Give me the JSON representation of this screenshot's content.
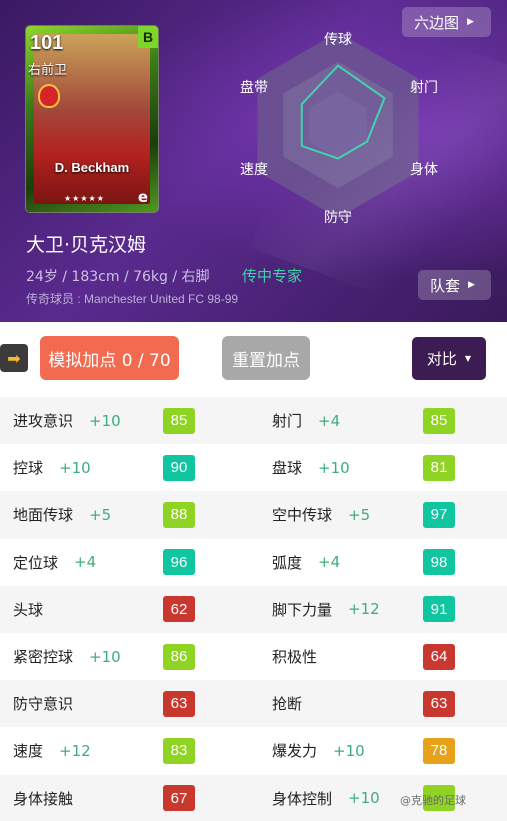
{
  "card": {
    "rating": "101",
    "grade": "B",
    "position": "右前卫",
    "name": "D. Beckham",
    "stars": "★★★★★",
    "e_mark": "e"
  },
  "radar": {
    "labels": [
      "传球",
      "射门",
      "身体",
      "防守",
      "速度",
      "盘带"
    ],
    "values": [
      0.85,
      0.77,
      0.48,
      0.48,
      0.6,
      0.6
    ],
    "fill_color": "#6f5a9a",
    "stroke_color": "#3fd3b0"
  },
  "buttons": {
    "hexagon": "六边图",
    "kit": "队套",
    "simulate": "模拟加点 0 / 70",
    "reset": "重置加点",
    "compare": "对比"
  },
  "player": {
    "name": "大卫·贝克汉姆",
    "info": "24岁 / 183cm / 76kg / 右脚",
    "trait": "传中专家",
    "club": "传奇球员 : Manchester United FC 98-99"
  },
  "colors": {
    "green": "#8fd323",
    "teal": "#10c6a0",
    "red": "#c8382e",
    "orange": "#e8a21a"
  },
  "stats": [
    {
      "left": {
        "name": "进攻意识",
        "bonus": "+10",
        "value": "85",
        "color": "#8fd323"
      },
      "right": {
        "name": "射门",
        "bonus": "+4",
        "value": "85",
        "color": "#8fd323"
      }
    },
    {
      "left": {
        "name": "控球",
        "bonus": "+10",
        "value": "90",
        "color": "#10c6a0"
      },
      "right": {
        "name": "盘球",
        "bonus": "+10",
        "value": "81",
        "color": "#8fd323"
      }
    },
    {
      "left": {
        "name": "地面传球",
        "bonus": "+5",
        "value": "88",
        "color": "#8fd323"
      },
      "right": {
        "name": "空中传球",
        "bonus": "+5",
        "value": "97",
        "color": "#10c6a0"
      }
    },
    {
      "left": {
        "name": "定位球",
        "bonus": "+4",
        "value": "96",
        "color": "#10c6a0"
      },
      "right": {
        "name": "弧度",
        "bonus": "+4",
        "value": "98",
        "color": "#10c6a0"
      }
    },
    {
      "left": {
        "name": "头球",
        "bonus": "",
        "value": "62",
        "color": "#c8382e"
      },
      "right": {
        "name": "脚下力量",
        "bonus": "+12",
        "value": "91",
        "color": "#10c6a0"
      }
    },
    {
      "left": {
        "name": "紧密控球",
        "bonus": "+10",
        "value": "86",
        "color": "#8fd323"
      },
      "right": {
        "name": "积极性",
        "bonus": "",
        "value": "64",
        "color": "#c8382e"
      }
    },
    {
      "left": {
        "name": "防守意识",
        "bonus": "",
        "value": "63",
        "color": "#c8382e"
      },
      "right": {
        "name": "抢断",
        "bonus": "",
        "value": "63",
        "color": "#c8382e"
      }
    },
    {
      "left": {
        "name": "速度",
        "bonus": "+12",
        "value": "83",
        "color": "#8fd323"
      },
      "right": {
        "name": "爆发力",
        "bonus": "+10",
        "value": "78",
        "color": "#e8a21a"
      }
    },
    {
      "left": {
        "name": "身体接触",
        "bonus": "",
        "value": "67",
        "color": "#c8382e"
      },
      "right": {
        "name": "身体控制",
        "bonus": "+10",
        "value": "",
        "color": "#8fd323"
      }
    }
  ],
  "watermark": "@克驰的足球"
}
